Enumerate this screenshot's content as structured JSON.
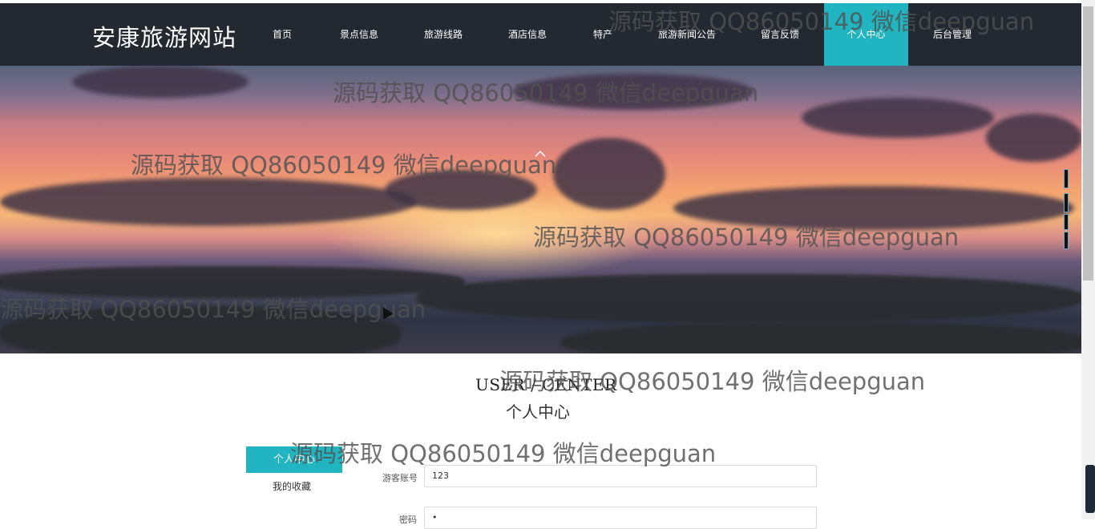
{
  "site": {
    "logo": "安康旅游网站"
  },
  "nav": {
    "items": [
      {
        "label": "首页"
      },
      {
        "label": "景点信息"
      },
      {
        "label": "旅游线路"
      },
      {
        "label": "酒店信息"
      },
      {
        "label": "特产"
      },
      {
        "label": "旅游新闻公告"
      },
      {
        "label": "留言反馈"
      },
      {
        "label": "个人中心",
        "active": true
      },
      {
        "label": "后台管理"
      }
    ]
  },
  "hero": {
    "up_icon": "chevron-up-icon",
    "down_icon": "chevron-down-icon"
  },
  "watermark": "源码获取 QQ86050149 微信deepguan",
  "section": {
    "title_en": "USER / CENTER",
    "title_cn": "个人中心"
  },
  "sidebar": {
    "items": [
      {
        "label": "个人中心",
        "active": true
      },
      {
        "label": "我的收藏"
      }
    ]
  },
  "form": {
    "fields": [
      {
        "label": "游客账号",
        "value": "123"
      },
      {
        "label": "密码",
        "value": "•"
      }
    ]
  },
  "colors": {
    "nav_bg": "#242830",
    "accent": "#21b5c2"
  }
}
